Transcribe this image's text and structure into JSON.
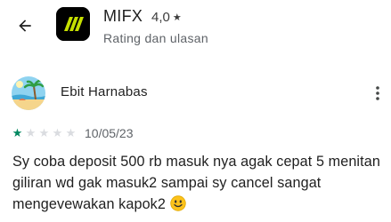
{
  "header": {
    "back_icon": "arrow-left-icon",
    "app_name": "MIFX",
    "rating_value": "4,0",
    "rating_star": "★",
    "subtitle": "Rating dan ulasan"
  },
  "review": {
    "reviewer_name": "Ebit Harnabas",
    "avatar_icon": "beach-avatar",
    "more_icon": "more-vert-icon",
    "stars": [
      "★",
      "★",
      "★",
      "★",
      "★"
    ],
    "rating": 1,
    "rating_max": 5,
    "date": "10/05/23",
    "text": "Sy coba deposit 500 rb masuk nya agak cepat 5 menitan giliran wd gak masuk2 sampai sy cancel sangat mengevewakan kapok2",
    "emoji": "slightly-smiling-face"
  },
  "colors": {
    "star_filled": "#01875f",
    "star_empty": "#dadce0",
    "app_icon_stripes": "#c6e000"
  }
}
